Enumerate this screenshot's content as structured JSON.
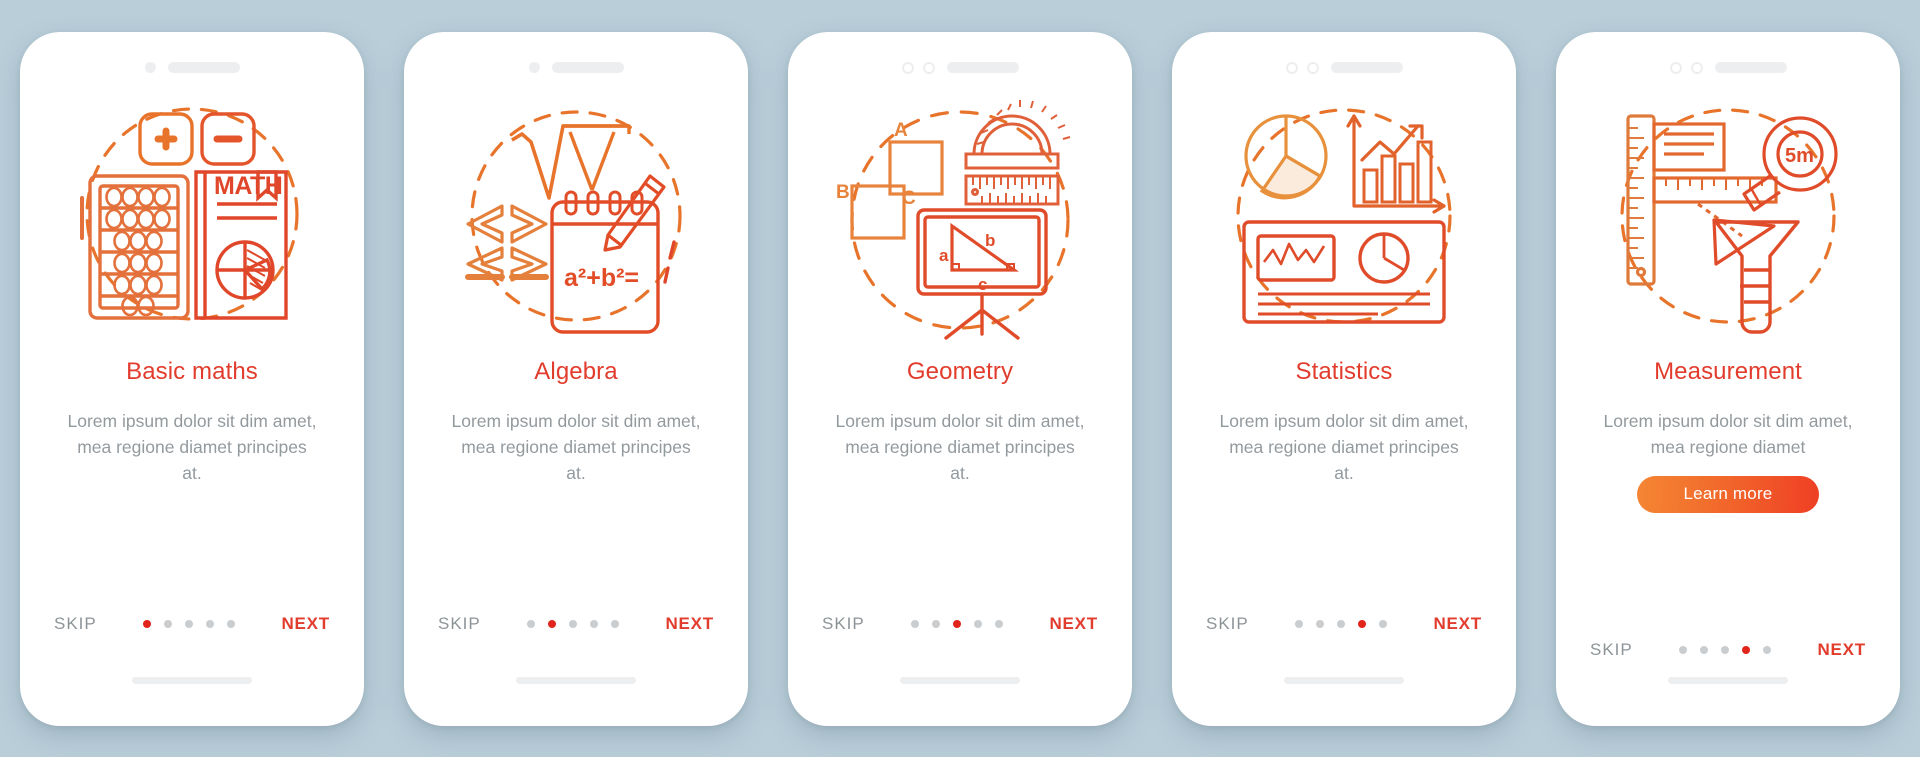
{
  "background_color": "#b9ced9",
  "accent_color": "#e23c2d",
  "muted_color": "#939a9e",
  "dot_active_color": "#e1251b",
  "common": {
    "skip_label": "SKIP",
    "next_label": "NEXT",
    "body_text": "Lorem ipsum dolor sit dim amet, mea regione diamet principes at.",
    "body_text_short": "Lorem ipsum dolor sit dim amet, mea regione diamet",
    "total_dots": 5
  },
  "screens": [
    {
      "id": "basic-maths",
      "title": "Basic maths",
      "body": "Lorem ipsum dolor sit dim amet, mea regione diamet principes at.",
      "active_dot": 0,
      "skip_label": "SKIP",
      "next_label": "NEXT",
      "has_learn_more": false,
      "learn_more_label": "",
      "notch_style": "dot",
      "illustration": "abacus-math-book-plus-minus-icon",
      "illustration_texts": [
        "MATH",
        "+",
        "-"
      ]
    },
    {
      "id": "algebra",
      "title": "Algebra",
      "body": "Lorem ipsum dolor sit dim amet, mea regione diamet principes at.",
      "active_dot": 1,
      "skip_label": "SKIP",
      "next_label": "NEXT",
      "has_learn_more": false,
      "learn_more_label": "",
      "notch_style": "dot",
      "illustration": "square-root-notepad-pencil-icon",
      "illustration_texts": [
        "√x",
        "a²+b²=",
        "<",
        ">",
        "≥",
        "≤"
      ]
    },
    {
      "id": "geometry",
      "title": "Geometry",
      "body": "Lorem ipsum dolor sit dim amet, mea regione diamet principes at.",
      "active_dot": 2,
      "skip_label": "SKIP",
      "next_label": "NEXT",
      "has_learn_more": false,
      "learn_more_label": "",
      "notch_style": "rings",
      "illustration": "protractor-ruler-blackboard-triangle-icon",
      "illustration_texts": [
        "A",
        "B",
        "C",
        "a",
        "b",
        "c"
      ]
    },
    {
      "id": "statistics",
      "title": "Statistics",
      "body": "Lorem ipsum dolor sit dim amet, mea regione diamet principes at.",
      "active_dot": 3,
      "skip_label": "SKIP",
      "next_label": "NEXT",
      "has_learn_more": false,
      "learn_more_label": "",
      "notch_style": "rings",
      "illustration": "pie-chart-bar-chart-report-icon",
      "illustration_texts": []
    },
    {
      "id": "measurement",
      "title": "Measurement",
      "body": "Lorem ipsum dolor sit dim amet, mea regione diamet",
      "active_dot": 3,
      "skip_label": "SKIP",
      "next_label": "NEXT",
      "has_learn_more": true,
      "learn_more_label": "Learn more",
      "notch_style": "rings",
      "illustration": "ruler-tape-measure-beaker-icon",
      "illustration_texts": [
        "5m"
      ]
    }
  ]
}
